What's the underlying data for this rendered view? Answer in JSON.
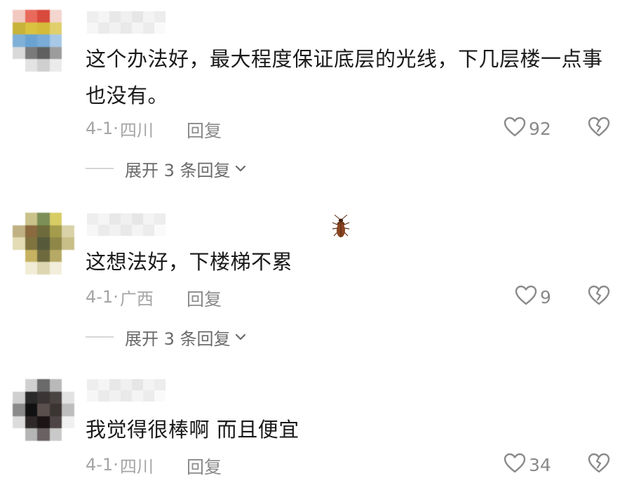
{
  "colors": {
    "text": "#1a1a1a",
    "meta": "#a5a5a5",
    "action": "#8a8a8a",
    "expand": "#6a6a6a"
  },
  "comments": [
    {
      "text": "这个办法好，最大程度保证底层的光线，下几层楼一点事也没有。",
      "date": "4-1·",
      "location": "四川",
      "reply_label": "回复",
      "likes": "92",
      "expand_label": "展开 3 条回复"
    },
    {
      "text": "这想法好，下楼梯不累",
      "date": "4-1·",
      "location": "广西",
      "reply_label": "回复",
      "likes": "9",
      "expand_label": "展开 3 条回复"
    },
    {
      "text": "我觉得很棒啊 而且便宜",
      "date": "4-1·",
      "location": "四川",
      "reply_label": "回复",
      "likes": "34"
    }
  ],
  "icons": {
    "like": "heart-outline-icon",
    "dislike": "broken-heart-icon",
    "expand": "chevron-down-icon",
    "sticker": "cockroach-icon"
  }
}
